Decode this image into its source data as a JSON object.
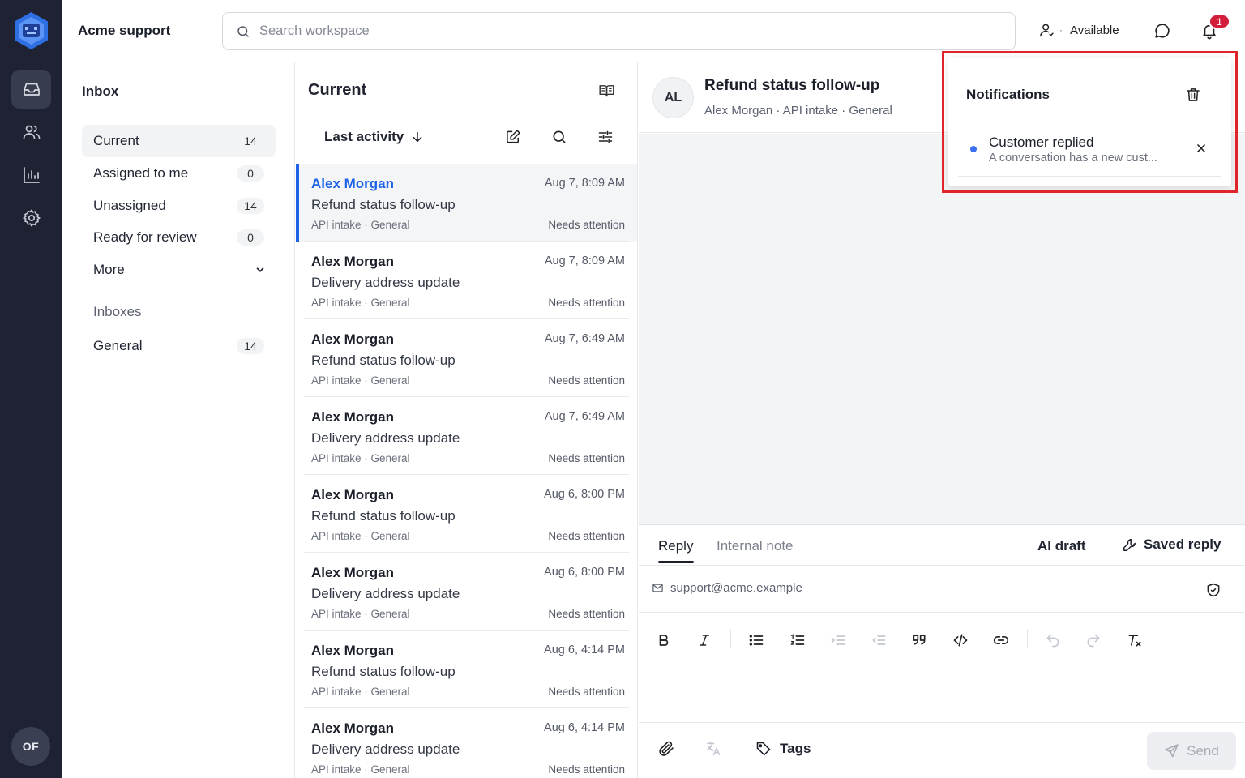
{
  "app": {
    "brand": "Acme support",
    "user_initials": "OF"
  },
  "search": {
    "placeholder": "Search workspace"
  },
  "topbar": {
    "status_label": "Available",
    "notification_count": "1"
  },
  "sidebar": {
    "title": "Inbox",
    "items": [
      {
        "label": "Current",
        "count": "14"
      },
      {
        "label": "Assigned to me",
        "count": "0"
      },
      {
        "label": "Unassigned",
        "count": "14"
      },
      {
        "label": "Ready for review",
        "count": "0"
      }
    ],
    "more_label": "More",
    "section_title": "Inboxes",
    "inboxes": [
      {
        "label": "General",
        "count": "14"
      }
    ]
  },
  "list": {
    "title": "Current",
    "sort_label": "Last activity",
    "conversations": [
      {
        "name": "Alex Morgan",
        "subject": "Refund status follow-up",
        "meta": "API intake · General",
        "time": "Aug 7, 8:09 AM",
        "flag": "Needs attention"
      },
      {
        "name": "Alex Morgan",
        "subject": "Delivery address update",
        "meta": "API intake · General",
        "time": "Aug 7, 8:09 AM",
        "flag": "Needs attention"
      },
      {
        "name": "Alex Morgan",
        "subject": "Refund status follow-up",
        "meta": "API intake · General",
        "time": "Aug 7, 6:49 AM",
        "flag": "Needs attention"
      },
      {
        "name": "Alex Morgan",
        "subject": "Delivery address update",
        "meta": "API intake · General",
        "time": "Aug 7, 6:49 AM",
        "flag": "Needs attention"
      },
      {
        "name": "Alex Morgan",
        "subject": "Refund status follow-up",
        "meta": "API intake · General",
        "time": "Aug 6, 8:00 PM",
        "flag": "Needs attention"
      },
      {
        "name": "Alex Morgan",
        "subject": "Delivery address update",
        "meta": "API intake · General",
        "time": "Aug 6, 8:00 PM",
        "flag": "Needs attention"
      },
      {
        "name": "Alex Morgan",
        "subject": "Refund status follow-up",
        "meta": "API intake · General",
        "time": "Aug 6, 4:14 PM",
        "flag": "Needs attention"
      },
      {
        "name": "Alex Morgan",
        "subject": "Delivery address update",
        "meta": "API intake · General",
        "time": "Aug 6, 4:14 PM",
        "flag": "Needs attention"
      }
    ]
  },
  "detail": {
    "avatar": "AL",
    "title": "Refund status follow-up",
    "meta": "Alex Morgan  ·  API intake  ·  General"
  },
  "composer": {
    "tab_reply": "Reply",
    "tab_note": "Internal note",
    "ai_draft": "AI draft",
    "saved_reply": "Saved reply",
    "from_address": "support@acme.example",
    "tags_label": "Tags",
    "send_label": "Send"
  },
  "notifications": {
    "title": "Notifications",
    "items": [
      {
        "title": "Customer replied",
        "body": "A conversation has a new cust..."
      }
    ]
  },
  "colors": {
    "rail": "#1e2233",
    "accent": "#1e62e8",
    "highlight": "#e0252a",
    "badge": "#d21e3a"
  }
}
